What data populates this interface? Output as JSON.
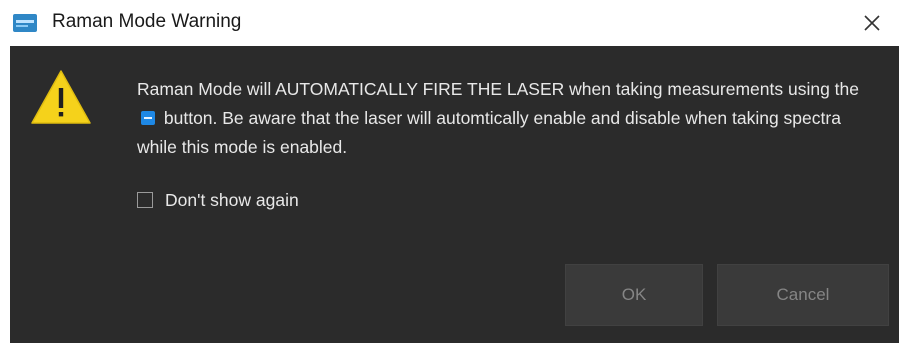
{
  "window": {
    "title": "Raman Mode Warning"
  },
  "icons": {
    "app": "app-logo-icon",
    "close": "close-icon",
    "warning": "warning-triangle-icon",
    "inline_button": "measure-button-icon"
  },
  "message": {
    "part1": "Raman Mode will AUTOMATICALLY FIRE THE LASER when taking measurements using the",
    "part2": "button. Be aware that the laser will automtically enable and disable when taking spectra while this mode is enabled."
  },
  "checkbox": {
    "label": "Don't show again",
    "checked": false
  },
  "buttons": {
    "ok": "OK",
    "cancel": "Cancel"
  },
  "colors": {
    "dialog_background": "#2b2b2b",
    "warning_yellow": "#f5d21b",
    "accent_blue": "#1e88e5"
  }
}
